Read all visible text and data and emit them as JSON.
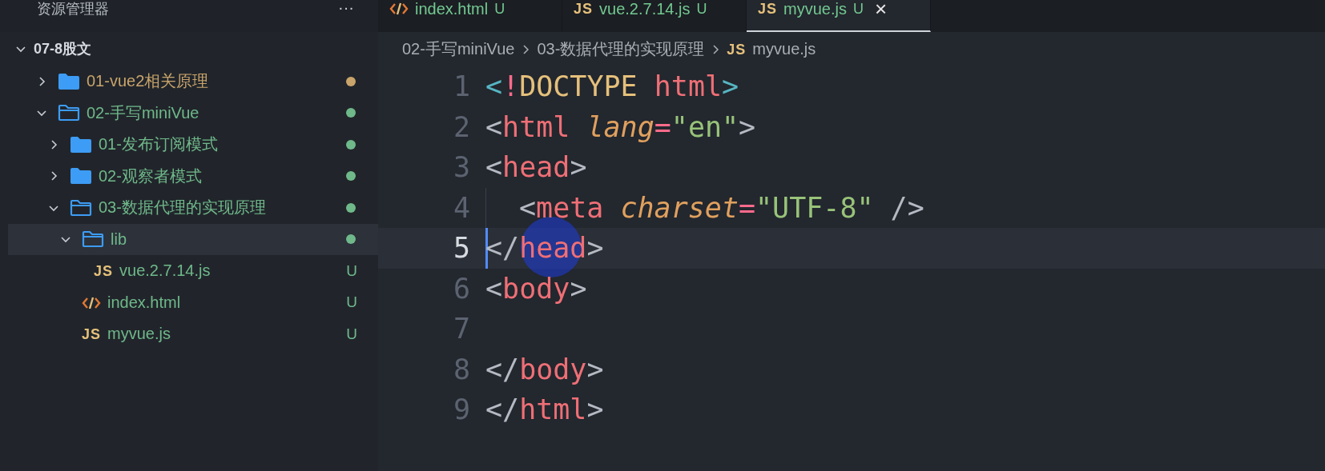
{
  "explorer": {
    "title": "资源管理器",
    "more": "···",
    "root": {
      "name": "07-8股文",
      "expanded": true,
      "children": [
        {
          "name": "01-vue2相关原理",
          "kind": "folder",
          "expanded": false,
          "selected": false,
          "color": "#c9a46b"
        },
        {
          "name": "02-手写miniVue",
          "kind": "folder",
          "expanded": true,
          "selected": false,
          "color": "#6fb88a",
          "children": [
            {
              "name": "01-发布订阅模式",
              "kind": "folder",
              "expanded": false,
              "selected": false,
              "color": "#6fb88a"
            },
            {
              "name": "02-观察者模式",
              "kind": "folder",
              "expanded": false,
              "selected": false,
              "color": "#6fb88a"
            },
            {
              "name": "03-数据代理的实现原理",
              "kind": "folder",
              "expanded": true,
              "selected": false,
              "color": "#6fb88a",
              "children": [
                {
                  "name": "lib",
                  "kind": "folder",
                  "expanded": true,
                  "selected": true,
                  "color": "#6fb88a",
                  "children": [
                    {
                      "name": "vue.2.7.14.js",
                      "kind": "js",
                      "icon_label": "JS",
                      "selected": false,
                      "badge": "U",
                      "color": "#6fb88a"
                    }
                  ]
                },
                {
                  "name": "index.html",
                  "kind": "html",
                  "selected": false,
                  "badge": "U",
                  "color": "#6fb88a"
                },
                {
                  "name": "myvue.js",
                  "kind": "js",
                  "icon_label": "JS",
                  "selected": false,
                  "badge": "U",
                  "color": "#6fb88a"
                }
              ]
            }
          ]
        }
      ]
    }
  },
  "tabs": [
    {
      "label": "index.html",
      "kind": "html",
      "badge": "U",
      "selected": false
    },
    {
      "label": "vue.2.7.14.js",
      "kind": "js",
      "icon_label": "JS",
      "badge": "U",
      "selected": false
    },
    {
      "label": "myvue.js",
      "kind": "js",
      "icon_label": "JS",
      "badge": "U",
      "selected": true,
      "close": "×"
    }
  ],
  "breadcrumbs": [
    {
      "label": "02-手写miniVue"
    },
    {
      "label": "03-数据代理的实现原理"
    },
    {
      "label": "myvue.js",
      "kind": "js",
      "icon_label": "JS"
    }
  ],
  "editor": {
    "lines": [
      {
        "number": "1",
        "current": false,
        "tokens": [
          {
            "t": "<",
            "kind": "cyan"
          },
          {
            "t": "!",
            "kind": "op"
          },
          {
            "t": "DOCTYPE",
            "kind": "keyword"
          },
          {
            "t": " html",
            "kind": "tag"
          },
          {
            "t": ">",
            "kind": "cyan"
          }
        ]
      },
      {
        "number": "2",
        "current": false,
        "tokens": [
          {
            "t": "<",
            "kind": "punct"
          },
          {
            "t": "html",
            "kind": "tag"
          },
          {
            "t": " lang",
            "kind": "attr"
          },
          {
            "t": "=",
            "kind": "op"
          },
          {
            "t": "\"en\"",
            "kind": "string"
          },
          {
            "t": ">",
            "kind": "punct"
          }
        ]
      },
      {
        "number": "3",
        "current": false,
        "tokens": [
          {
            "t": "<",
            "kind": "punct"
          },
          {
            "t": "head",
            "kind": "tag"
          },
          {
            "t": ">",
            "kind": "punct"
          }
        ]
      },
      {
        "number": "4",
        "current": false,
        "indented": true,
        "tokens": [
          {
            "t": "<",
            "kind": "punct"
          },
          {
            "t": "meta",
            "kind": "tag"
          },
          {
            "t": " charset",
            "kind": "attr"
          },
          {
            "t": "=",
            "kind": "op"
          },
          {
            "t": "\"UTF-8\"",
            "kind": "string"
          },
          {
            "t": " />",
            "kind": "punct"
          }
        ]
      },
      {
        "number": "5",
        "current": true,
        "click_marker": true,
        "tokens": [
          {
            "t": "</",
            "kind": "punct"
          },
          {
            "t": "head",
            "kind": "tag"
          },
          {
            "t": ">",
            "kind": "punct"
          }
        ]
      },
      {
        "number": "6",
        "current": false,
        "tokens": [
          {
            "t": "<",
            "kind": "punct"
          },
          {
            "t": "body",
            "kind": "tag"
          },
          {
            "t": ">",
            "kind": "punct"
          }
        ]
      },
      {
        "number": "7",
        "current": false
      },
      {
        "number": "8",
        "current": false,
        "tokens": [
          {
            "t": "</",
            "kind": "punct"
          },
          {
            "t": "body",
            "kind": "tag"
          },
          {
            "t": ">",
            "kind": "punct"
          }
        ]
      },
      {
        "number": "9",
        "current": false,
        "tokens": [
          {
            "t": "</",
            "kind": "punct"
          },
          {
            "t": "html",
            "kind": "tag"
          },
          {
            "t": ">",
            "kind": "punct"
          }
        ]
      }
    ]
  }
}
